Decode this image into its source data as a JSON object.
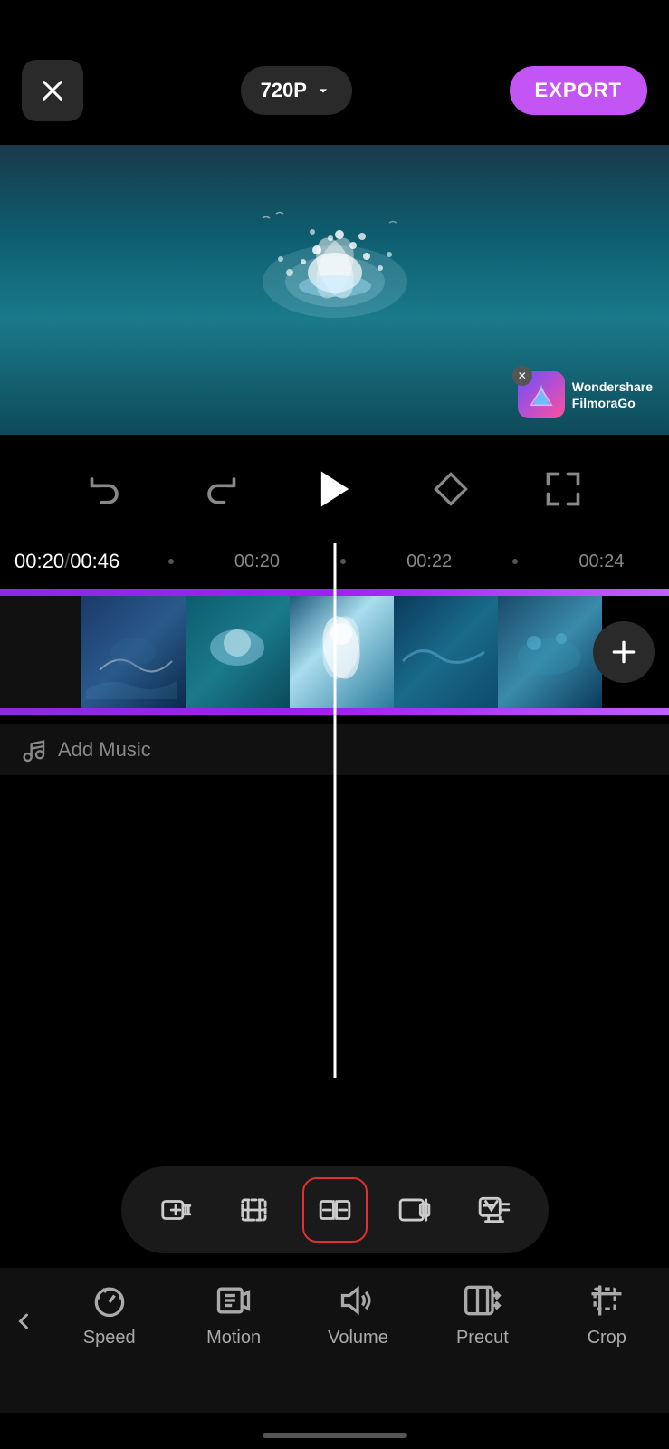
{
  "header": {
    "close_label": "×",
    "quality_label": "720P",
    "export_label": "EXPORT"
  },
  "watermark": {
    "brand": "Wondershare\nFilmoraGo"
  },
  "playback": {
    "current_time": "00:20",
    "total_time": "00:46",
    "time_separator": "/",
    "markers": [
      "00:20",
      "00:22",
      "00:24"
    ],
    "undo_label": "undo",
    "redo_label": "redo",
    "play_label": "play",
    "keyframe_label": "keyframe",
    "fullscreen_label": "fullscreen"
  },
  "add_music_label": "Add Music",
  "toolbar": {
    "split_label": "split",
    "trim_label": "trim",
    "edit_label": "edit",
    "adjust_label": "adjust",
    "effects_label": "effects"
  },
  "bottom_nav": {
    "back_label": "<",
    "items": [
      {
        "id": "speed",
        "label": "Speed"
      },
      {
        "id": "motion",
        "label": "Motion"
      },
      {
        "id": "volume",
        "label": "Volume"
      },
      {
        "id": "precut",
        "label": "Precut"
      },
      {
        "id": "crop",
        "label": "Crop"
      }
    ]
  }
}
